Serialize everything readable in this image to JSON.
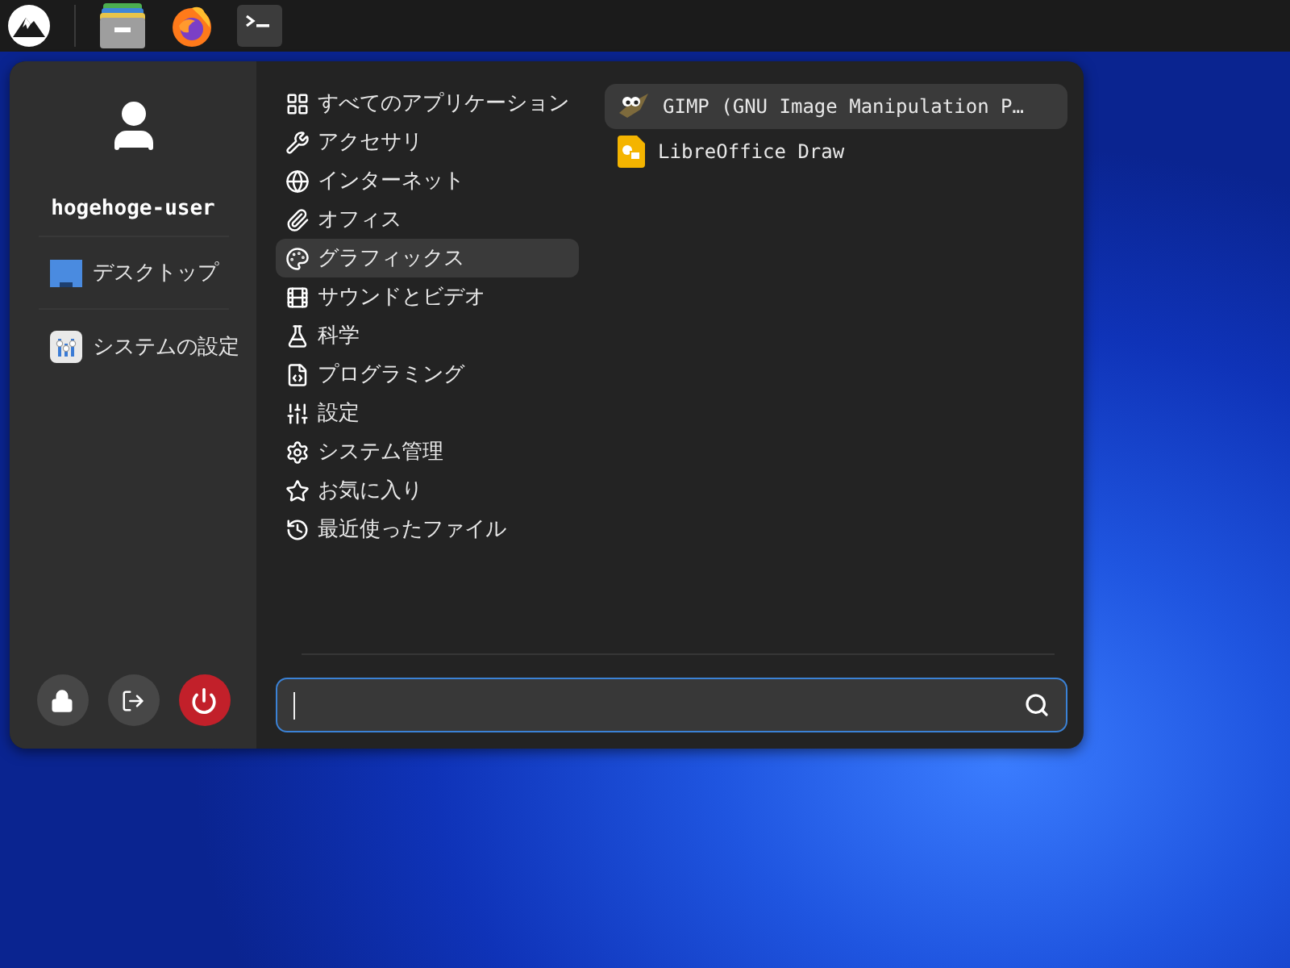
{
  "user": {
    "name": "hogehoge-user"
  },
  "places": [
    {
      "label": "デスクトップ"
    },
    {
      "label": "システムの設定"
    }
  ],
  "categories": [
    {
      "label": "すべてのアプリケーション",
      "selected": false
    },
    {
      "label": "アクセサリ",
      "selected": false
    },
    {
      "label": "インターネット",
      "selected": false
    },
    {
      "label": "オフィス",
      "selected": false
    },
    {
      "label": "グラフィックス",
      "selected": true
    },
    {
      "label": "サウンドとビデオ",
      "selected": false
    },
    {
      "label": "科学",
      "selected": false
    },
    {
      "label": "プログラミング",
      "selected": false
    },
    {
      "label": "設定",
      "selected": false
    },
    {
      "label": "システム管理",
      "selected": false
    },
    {
      "label": "お気に入り",
      "selected": false
    },
    {
      "label": "最近使ったファイル",
      "selected": false
    }
  ],
  "apps": [
    {
      "label": "GIMP (GNU Image Manipulation P…",
      "selected": true
    },
    {
      "label": "LibreOffice Draw",
      "selected": false
    }
  ],
  "search": {
    "focused": true
  }
}
